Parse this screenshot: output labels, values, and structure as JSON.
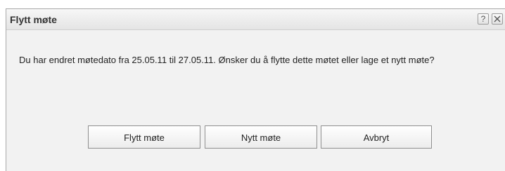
{
  "dialog": {
    "title": "Flytt møte",
    "help_label": "?",
    "close_icon": "close-icon",
    "message": "Du har endret møtedato fra 25.05.11 til 27.05.11. Ønsker du å flytte dette møtet eller lage et nytt møte?",
    "buttons": {
      "move": "Flytt møte",
      "new": "Nytt møte",
      "cancel": "Avbryt"
    }
  }
}
